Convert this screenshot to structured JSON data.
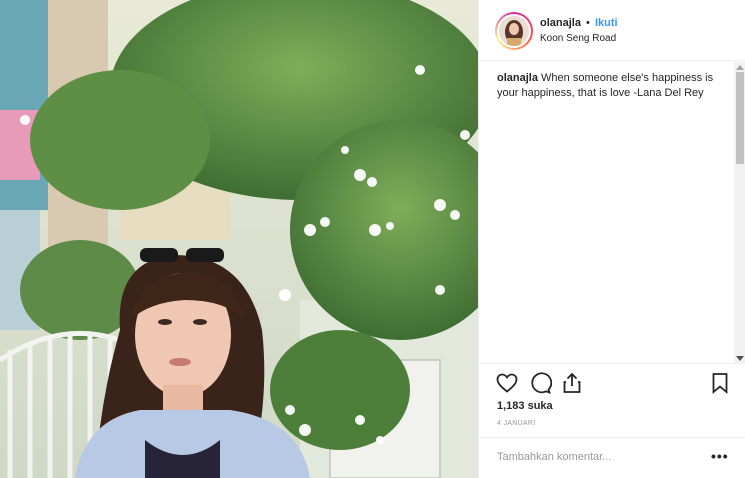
{
  "post": {
    "username": "olanajla",
    "separator": "•",
    "follow_label": "Ikuti",
    "location": "Koon Seng Road",
    "caption_user": "olanajla",
    "caption_text": "When someone else's happiness is your happiness, that is love -Lana Del Rey",
    "likes": "1,183 suka",
    "date": "4 JANUARI",
    "comment_placeholder": "Tambahkan komentar...",
    "more_label": "•••"
  },
  "icons": {
    "like": "heart-icon",
    "comment": "comment-icon",
    "share": "share-icon",
    "save": "bookmark-icon"
  },
  "colors": {
    "accent": "#3897f0",
    "text": "#262626",
    "muted": "#999999",
    "divider": "#efefef"
  }
}
